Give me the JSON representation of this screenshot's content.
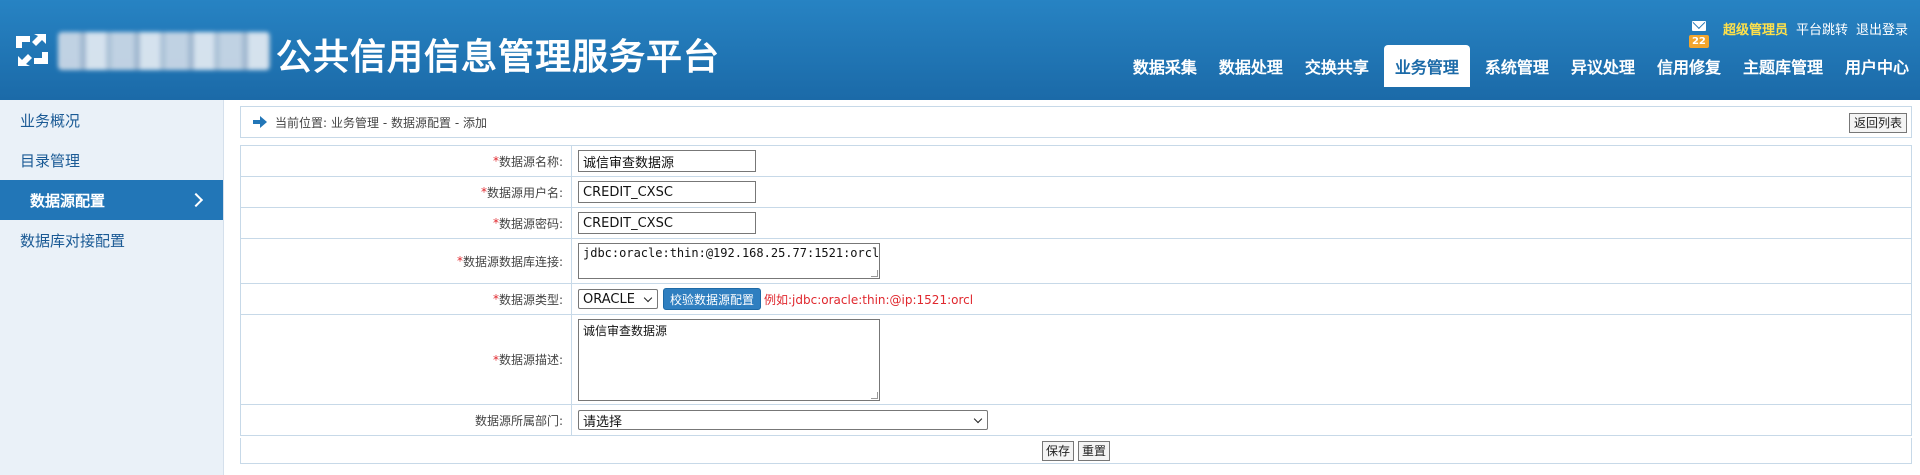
{
  "header": {
    "title": "公共信用信息管理服务平台",
    "logo_icon": "logo-refresh-icon",
    "mail_badge": "22",
    "user_name": "超级管理员",
    "platform_jump": "平台跳转",
    "logout": "退出登录",
    "colors": {
      "header_bg": "#2276b7",
      "admin_name": "#ffe14a",
      "badge": "#f2a52d"
    }
  },
  "nav": {
    "items": [
      {
        "label": "数据采集"
      },
      {
        "label": "数据处理"
      },
      {
        "label": "交换共享"
      },
      {
        "label": "业务管理",
        "active": true
      },
      {
        "label": "系统管理"
      },
      {
        "label": "异议处理"
      },
      {
        "label": "信用修复"
      },
      {
        "label": "主题库管理"
      },
      {
        "label": "用户中心"
      }
    ]
  },
  "sidebar": {
    "items": [
      {
        "label": "业务概况"
      },
      {
        "label": "目录管理"
      },
      {
        "label": "数据源配置",
        "active": true
      },
      {
        "label": "数据库对接配置"
      }
    ]
  },
  "breadcrumb": {
    "label": "当前位置:",
    "path": "业务管理 - 数据源配置 - 添加",
    "back_button": "返回列表"
  },
  "form": {
    "name": {
      "required": "*",
      "label": "数据源名称:",
      "value": "诚信审查数据源"
    },
    "username": {
      "required": "*",
      "label": "数据源用户名:",
      "value": "CREDIT_CXSC"
    },
    "password": {
      "required": "*",
      "label": "数据源密码:",
      "value": "CREDIT_CXSC"
    },
    "url": {
      "required": "*",
      "label": "数据源数据库连接:",
      "value": "jdbc:oracle:thin:@192.168.25.77:1521:orcl"
    },
    "type": {
      "required": "*",
      "label": "数据源类型:",
      "value": "ORACLE",
      "verify_button": "校验数据源配置",
      "hint": "例如:jdbc:oracle:thin:@ip:1521:orcl"
    },
    "desc": {
      "required": "*",
      "label": "数据源描述:",
      "value": "诚信审查数据源"
    },
    "dept": {
      "label": "数据源所属部门:",
      "value": "请选择"
    }
  },
  "actions": {
    "save": "保存",
    "reset": "重置"
  }
}
